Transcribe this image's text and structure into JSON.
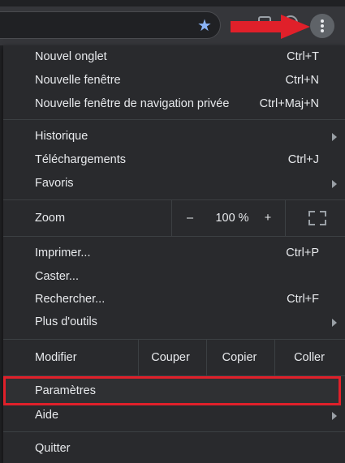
{
  "menu": {
    "group1": [
      {
        "label": "Nouvel onglet",
        "shortcut": "Ctrl+T"
      },
      {
        "label": "Nouvelle fenêtre",
        "shortcut": "Ctrl+N"
      },
      {
        "label": "Nouvelle fenêtre de navigation privée",
        "shortcut": "Ctrl+Maj+N"
      }
    ],
    "group2": [
      {
        "label": "Historique",
        "shortcut": ""
      },
      {
        "label": "Téléchargements",
        "shortcut": "Ctrl+J"
      },
      {
        "label": "Favoris",
        "shortcut": ""
      }
    ],
    "zoom": {
      "label": "Zoom",
      "minus": "–",
      "value": "100 %",
      "plus": "+"
    },
    "group3": [
      {
        "label": "Imprimer...",
        "shortcut": "Ctrl+P"
      },
      {
        "label": "Caster...",
        "shortcut": ""
      },
      {
        "label": "Rechercher...",
        "shortcut": "Ctrl+F"
      },
      {
        "label": "Plus d'outils",
        "shortcut": ""
      }
    ],
    "edit": {
      "label": "Modifier",
      "cut": "Couper",
      "copy": "Copier",
      "paste": "Coller"
    },
    "group4": [
      {
        "label": "Paramètres"
      },
      {
        "label": "Aide"
      }
    ],
    "quit": {
      "label": "Quitter"
    }
  },
  "colors": {
    "accent_red": "#e0202a",
    "star": "#8ab4f8",
    "menu_bg": "#292a2d"
  },
  "icons": [
    "star-icon",
    "extension-icon",
    "profile-icon",
    "kebab-menu-icon",
    "fullscreen-icon",
    "submenu-arrow-icon"
  ]
}
